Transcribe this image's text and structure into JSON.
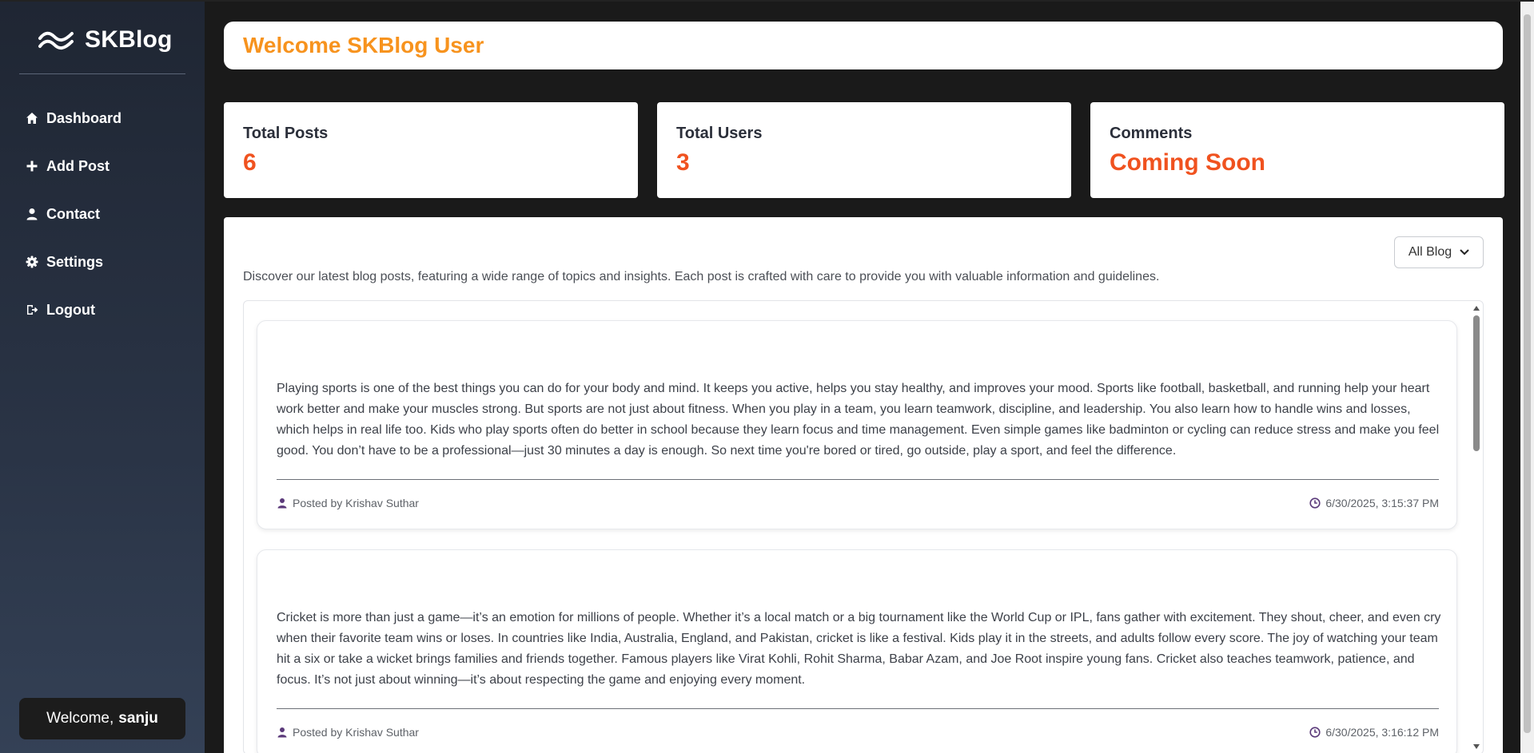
{
  "brand": {
    "name": "SKBlog"
  },
  "sidebar": {
    "items": [
      {
        "label": "Dashboard",
        "icon": "home-icon"
      },
      {
        "label": "Add Post",
        "icon": "plus-icon"
      },
      {
        "label": "Contact",
        "icon": "user-icon"
      },
      {
        "label": "Settings",
        "icon": "gear-icon"
      },
      {
        "label": "Logout",
        "icon": "logout-icon"
      }
    ],
    "welcome_prefix": "Welcome,",
    "welcome_user": "sanju"
  },
  "header": {
    "title": "Welcome SKBlog User"
  },
  "stats": [
    {
      "label": "Total Posts",
      "value": "6"
    },
    {
      "label": "Total Users",
      "value": "3"
    },
    {
      "label": "Comments",
      "value": "Coming Soon"
    }
  ],
  "main": {
    "filter": {
      "selected": "All Blog"
    },
    "intro": "Discover our latest blog posts, featuring a wide range of topics and insights. Each post is crafted with care to provide you with valuable information and guidelines."
  },
  "posts": [
    {
      "body": "Playing sports is one of the best things you can do for your body and mind. It keeps you active, helps you stay healthy, and improves your mood. Sports like football, basketball, and running help your heart work better and make your muscles strong. But sports are not just about fitness. When you play in a team, you learn teamwork, discipline, and leadership. You also learn how to handle wins and losses, which helps in real life too. Kids who play sports often do better in school because they learn focus and time management. Even simple games like badminton or cycling can reduce stress and make you feel good. You don’t have to be a professional—just 30 minutes a day is enough. So next time you're bored or tired, go outside, play a sport, and feel the difference.",
      "author": "Posted by Krishav Suthar",
      "date": "6/30/2025, 3:15:37 PM"
    },
    {
      "body": "Cricket is more than just a game—it’s an emotion for millions of people. Whether it’s a local match or a big tournament like the World Cup or IPL, fans gather with excitement. They shout, cheer, and even cry when their favorite team wins or loses. In countries like India, Australia, England, and Pakistan, cricket is like a festival. Kids play it in the streets, and adults follow every score. The joy of watching your team hit a six or take a wicket brings families and friends together. Famous players like Virat Kohli, Rohit Sharma, Babar Azam, and Joe Root inspire young fans. Cricket also teaches teamwork, patience, and focus. It’s not just about winning—it’s about respecting the game and enjoying every moment.",
      "author": "Posted by Krishav Suthar",
      "date": "6/30/2025, 3:16:12 PM"
    }
  ],
  "colors": {
    "accent": "#f7931e",
    "stat_value": "#f0521f",
    "meta_icon": "#5b3a7a"
  }
}
